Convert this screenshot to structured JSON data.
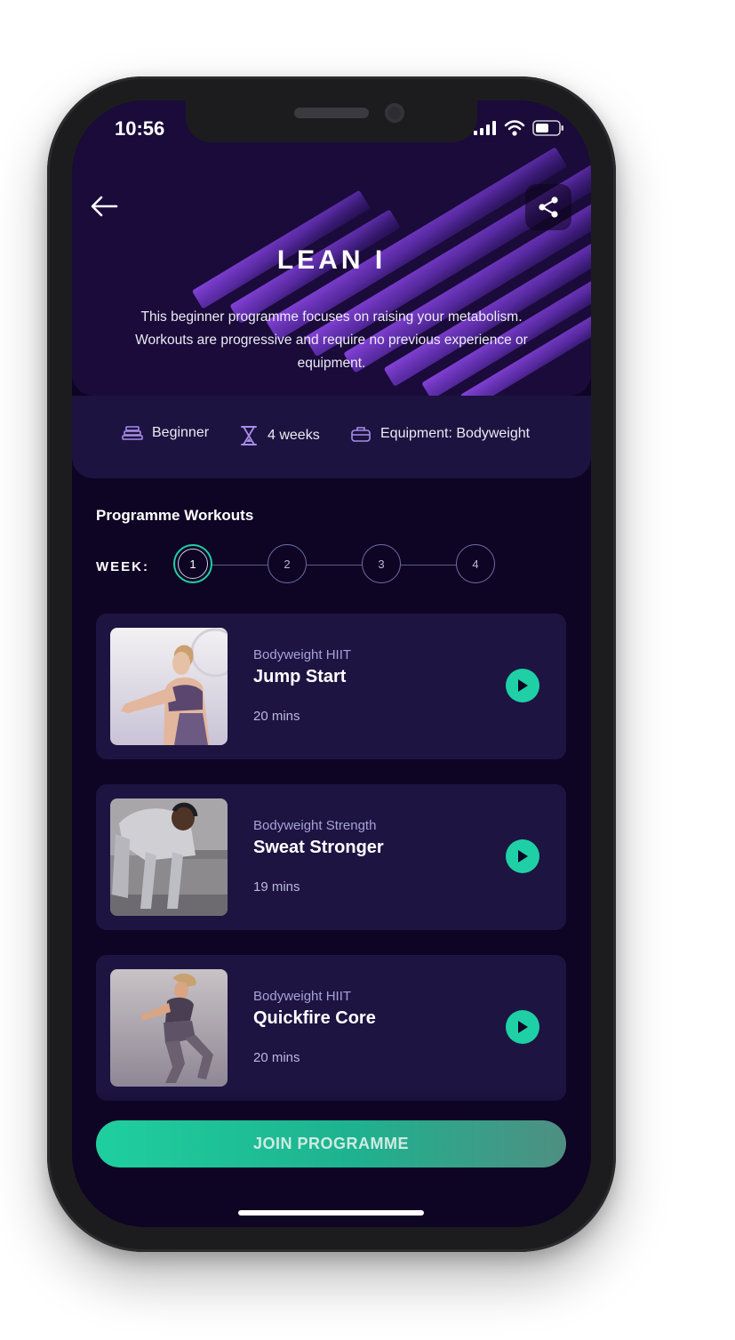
{
  "status": {
    "time": "10:56"
  },
  "hero": {
    "title": "LEAN I",
    "description": "This beginner programme focuses on raising your metabolism. Workouts are progressive and require no previous experience or equipment."
  },
  "info": {
    "level": "Beginner",
    "duration": "4 weeks",
    "equipment": "Equipment: Bodyweight"
  },
  "section": {
    "title": "Programme Workouts"
  },
  "weeks": {
    "label": "WEEK:",
    "items": [
      "1",
      "2",
      "3",
      "4"
    ],
    "selected": "1"
  },
  "workouts": [
    {
      "category": "Bodyweight HIIT",
      "name": "Jump Start",
      "duration": "20 mins"
    },
    {
      "category": "Bodyweight Strength",
      "name": "Sweat Stronger",
      "duration": "19 mins"
    },
    {
      "category": "Bodyweight HIIT",
      "name": "Quickfire Core",
      "duration": "20 mins"
    }
  ],
  "cta": {
    "label": "JOIN PROGRAMME"
  },
  "colors": {
    "background": "#0e0424",
    "card": "#1d1442",
    "accent": "#1fd0a6",
    "stripe": "#7b3fd0"
  },
  "icons": [
    "back-arrow-icon",
    "share-icon",
    "level-icon",
    "hourglass-icon",
    "equipment-bag-icon",
    "play-icon",
    "signal-icon",
    "wifi-icon",
    "battery-icon"
  ]
}
